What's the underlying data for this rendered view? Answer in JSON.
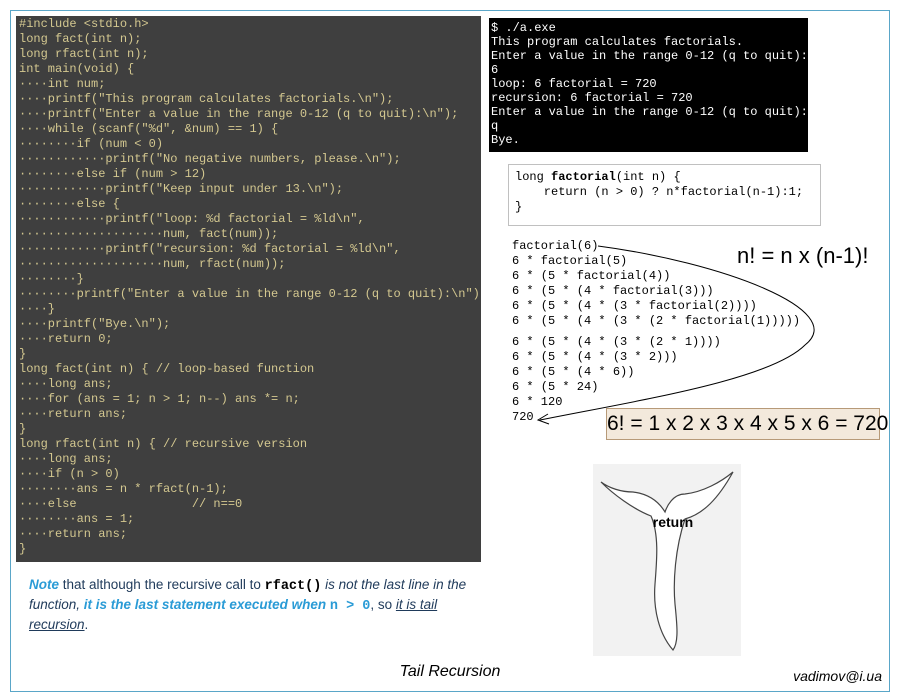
{
  "code": {
    "lines": [
      "#include <stdio.h>",
      "long fact(int n);",
      "long rfact(int n);",
      "int main(void) {",
      "····int num;",
      "····printf(\"This program calculates factorials.\\n\");",
      "····printf(\"Enter a value in the range 0-12 (q to quit):\\n\");",
      "····while (scanf(\"%d\", &num) == 1) {",
      "········if (num < 0)",
      "············printf(\"No negative numbers, please.\\n\");",
      "········else if (num > 12)",
      "············printf(\"Keep input under 13.\\n\");",
      "········else {",
      "············printf(\"loop: %d factorial = %ld\\n\",",
      "····················num, fact(num));",
      "············printf(\"recursion: %d factorial = %ld\\n\",",
      "····················num, rfact(num));",
      "········}",
      "········printf(\"Enter a value in the range 0-12 (q to quit):\\n\");",
      "····}",
      "····printf(\"Bye.\\n\");",
      "····return 0;",
      "}",
      "long fact(int n) { // loop-based function",
      "····long ans;",
      "····for (ans = 1; n > 1; n--) ans *= n;",
      "····return ans;",
      "}",
      "long rfact(int n) { // recursive version",
      "····long ans;",
      "····if (n > 0)",
      "········ans = n * rfact(n-1);",
      "····else                // n==0",
      "········ans = 1;",
      "····return ans;",
      "}"
    ]
  },
  "terminal": {
    "lines": [
      "$ ./a.exe",
      "This program calculates factorials.",
      "Enter a value in the range 0-12 (q to quit):",
      "6",
      "loop: 6 factorial = 720",
      "recursion: 6 factorial = 720",
      "Enter a value in the range 0-12 (q to quit):",
      "q",
      "Bye."
    ]
  },
  "snippet": {
    "line1_pre": "long ",
    "line1_bold": "factorial",
    "line1_post": "(int n) {",
    "line2": "    return (n > 0) ? n*factorial(n-1):1;",
    "line3": "}"
  },
  "expansion": {
    "lines": [
      "factorial(6)",
      "6 * factorial(5)",
      "6 * (5 * factorial(4))",
      "6 * (5 * (4 * factorial(3)))",
      "6 * (5 * (4 * (3 * factorial(2))))",
      "6 * (5 * (4 * (3 * (2 * factorial(1)))))",
      "6 * (5 * (4 * (3 * (2 * 1))))",
      "6 * (5 * (4 * (3 * 2)))",
      "6 * (5 * (4 * 6))",
      "6 * (5 * 24)",
      "6 * 120",
      "720"
    ]
  },
  "formulas": {
    "recurrence": "n! = n x (n-1)!",
    "six_factorial": "6! = 1 x 2 x 3 x 4 x 5 x 6 = 720"
  },
  "whale": {
    "label": "return"
  },
  "note": {
    "word_note": "Note",
    "part1": " that although the recursive call to ",
    "code_call": "rfact()",
    "part2": " is not the last line in the function, ",
    "emphasis": "it is the last statement executed when ",
    "code_cond": "n > 0",
    "part3": ", so ",
    "underlined": "it is tail recursion",
    "end": "."
  },
  "caption": "Tail Recursion",
  "author": "vadimov@i.ua",
  "colors": {
    "code_bg": "#3f3f3f",
    "terminal_bg": "#000000",
    "accent_blue": "#2a9bd6",
    "formula_bg": "#f3e9dc"
  }
}
